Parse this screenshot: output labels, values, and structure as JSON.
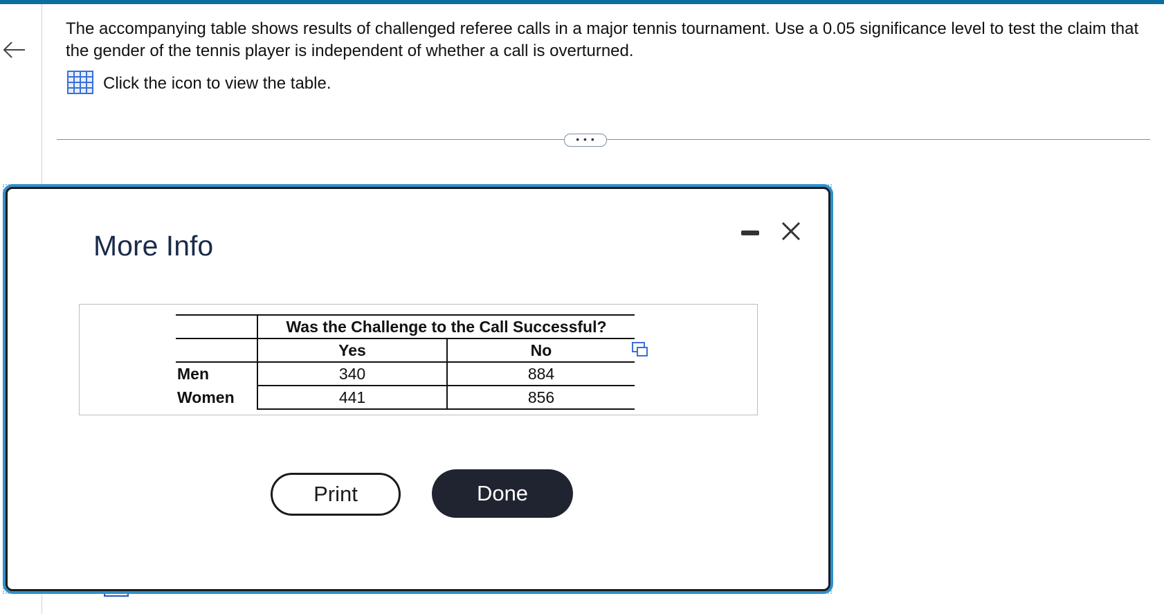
{
  "question": {
    "text": "The accompanying table shows results of challenged referee calls in a major tennis tournament. Use a 0.05 significance level to test the claim that the gender of the tennis player is independent of whether a call is overturned.",
    "hint": "Click the icon to view the table."
  },
  "divider": {
    "more_label": "• • •"
  },
  "modal": {
    "title": "More Info",
    "table": {
      "header": "Was the Challenge to the Call Successful?",
      "columns": [
        "Yes",
        "No"
      ],
      "rows": [
        {
          "label": "Men",
          "values": [
            "340",
            "884"
          ]
        },
        {
          "label": "Women",
          "values": [
            "441",
            "856"
          ]
        }
      ]
    },
    "print_label": "Print",
    "done_label": "Done"
  },
  "icons": [
    "back-arrow-icon",
    "table-grid-icon",
    "minimize-icon",
    "close-icon",
    "copy-icon"
  ],
  "colors": {
    "accent": "#0a6fa0",
    "modal_glow": "#2f8fcc",
    "done_bg": "#1f2430",
    "title": "#1a2a4a"
  }
}
